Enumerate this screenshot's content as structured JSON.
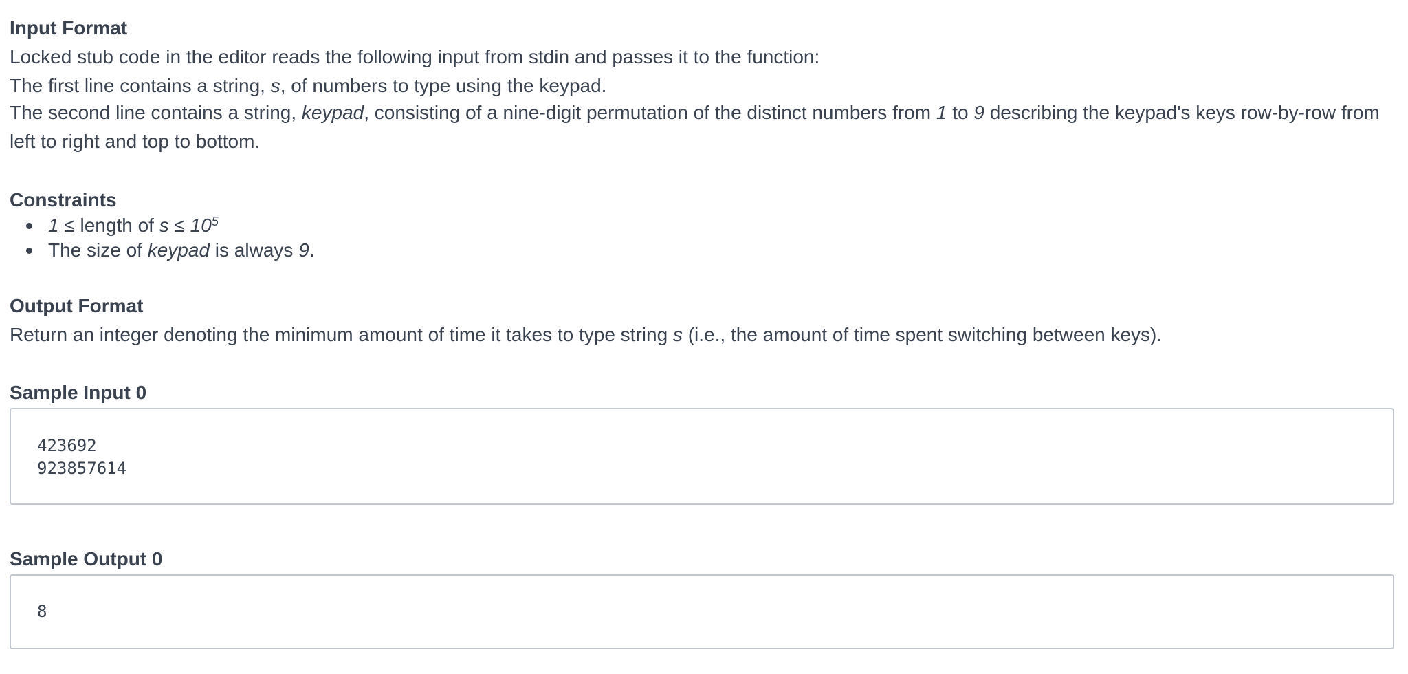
{
  "input_format": {
    "heading": "Input Format",
    "line1": "Locked stub code in the editor reads the following input from stdin and passes it to the function:",
    "line2_before": "The first line contains a string, ",
    "line2_var": "s",
    "line2_after": ", of numbers to type using the keypad.",
    "line3_before": "The second line contains a string, ",
    "line3_var": "keypad",
    "line3_mid": ", consisting of a nine-digit permutation of the distinct numbers from ",
    "line3_num1": "1",
    "line3_to": " to ",
    "line3_num2": "9",
    "line3_after": " describing the keypad's keys row-by-row from left to right and top to bottom."
  },
  "constraints": {
    "heading": "Constraints",
    "item1_start": "1",
    "item1_mid1": " ≤ length of ",
    "item1_var": "s",
    "item1_mid2": " ≤ ",
    "item1_base": "10",
    "item1_exp": "5",
    "item2_before": "The size of ",
    "item2_var": "keypad",
    "item2_mid": " is always ",
    "item2_num": "9",
    "item2_after": "."
  },
  "output_format": {
    "heading": "Output Format",
    "text_before": "Return an integer denoting the minimum amount of time it takes to type string ",
    "text_var": "s",
    "text_after": " (i.e., the amount of time spent switching between keys)."
  },
  "sample_input": {
    "heading": "Sample Input 0",
    "lines": [
      "423692",
      "923857614"
    ]
  },
  "sample_output": {
    "heading": "Sample Output 0",
    "lines": [
      "8"
    ]
  }
}
